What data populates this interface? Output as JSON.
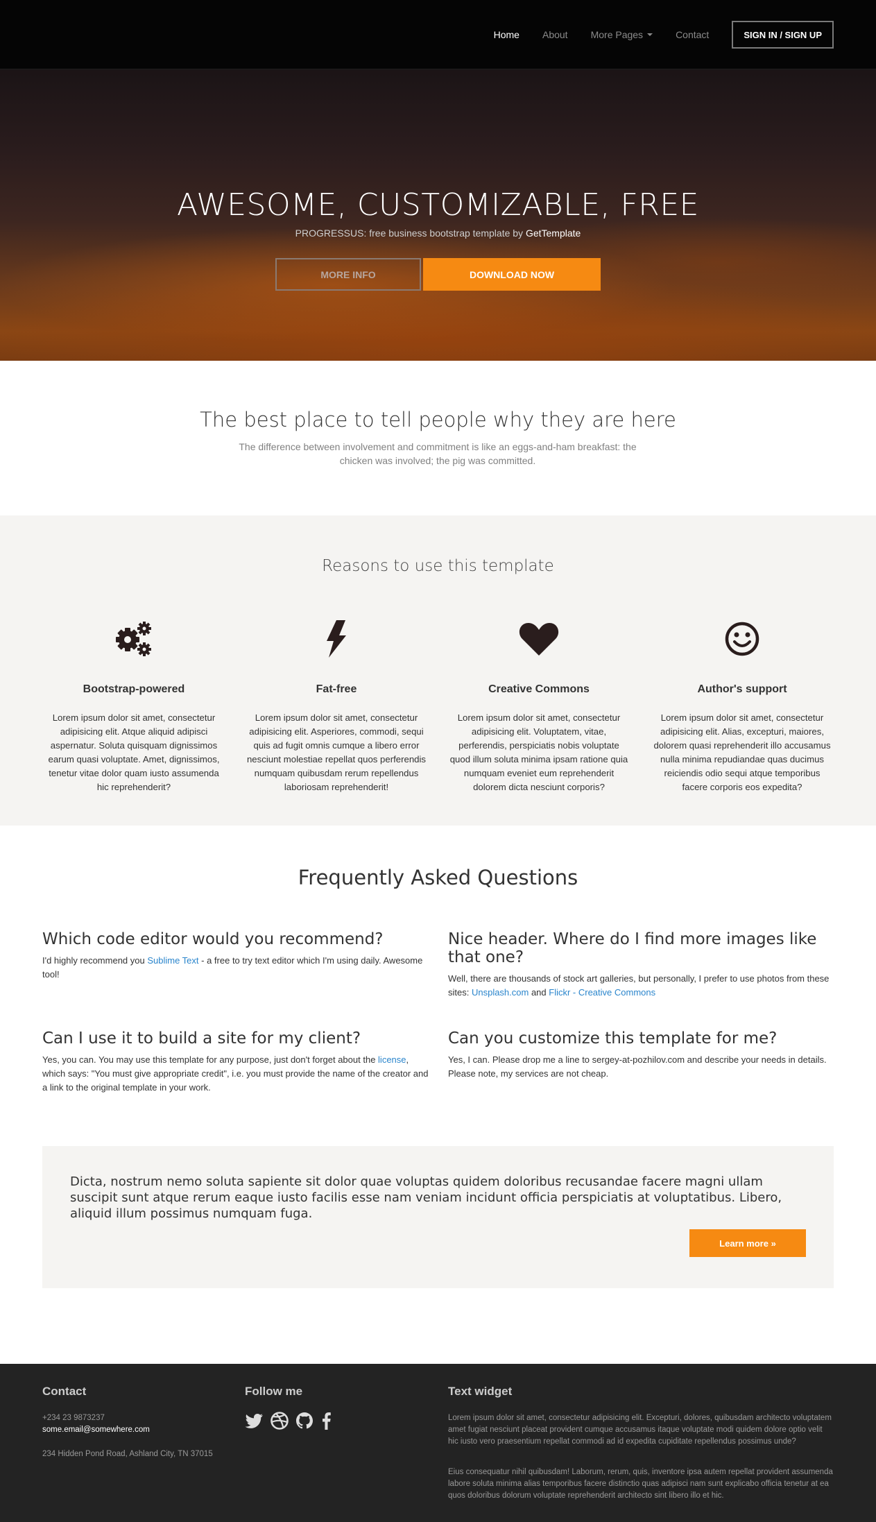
{
  "nav": {
    "items": [
      {
        "label": "Home"
      },
      {
        "label": "About"
      },
      {
        "label": "More Pages"
      },
      {
        "label": "Contact"
      }
    ],
    "signin_label": "SIGN IN / SIGN UP"
  },
  "hero": {
    "title": "AWESOME, CUSTOMIZABLE, FREE",
    "subtitle_prefix": "PROGRESSUS: free business bootstrap template by",
    "subtitle_brand": "GetTemplate",
    "more_info_label": "MORE INFO",
    "download_label": "DOWNLOAD NOW"
  },
  "tagline": {
    "title": "The best place to tell people why they are here",
    "text": "The difference between involvement and commitment is like an eggs-and-ham breakfast: the chicken was involved; the pig was committed."
  },
  "reasons": {
    "title": "Reasons to use this template",
    "features": [
      {
        "icon": "gears-icon",
        "title": "Bootstrap-powered",
        "text": "Lorem ipsum dolor sit amet, consectetur adipisicing elit. Atque aliquid adipisci aspernatur. Soluta quisquam dignissimos earum quasi voluptate. Amet, dignissimos, tenetur vitae dolor quam iusto assumenda hic reprehenderit?"
      },
      {
        "icon": "bolt-icon",
        "title": "Fat-free",
        "text": "Lorem ipsum dolor sit amet, consectetur adipisicing elit. Asperiores, commodi, sequi quis ad fugit omnis cumque a libero error nesciunt molestiae repellat quos perferendis numquam quibusdam rerum repellendus laboriosam reprehenderit!"
      },
      {
        "icon": "heart-icon",
        "title": "Creative Commons",
        "text": "Lorem ipsum dolor sit amet, consectetur adipisicing elit. Voluptatem, vitae, perferendis, perspiciatis nobis voluptate quod illum soluta minima ipsam ratione quia numquam eveniet eum reprehenderit dolorem dicta nesciunt corporis?"
      },
      {
        "icon": "smile-icon",
        "title": "Author's support",
        "text": "Lorem ipsum dolor sit amet, consectetur adipisicing elit. Alias, excepturi, maiores, dolorem quasi reprehenderit illo accusamus nulla minima repudiandae quas ducimus reiciendis odio sequi atque temporibus facere corporis eos expedita?"
      }
    ]
  },
  "faq": {
    "title": "Frequently Asked Questions",
    "q1": {
      "question": "Which code editor would you recommend?",
      "a_pre": "I'd highly recommend you ",
      "a_link": "Sublime Text",
      "a_post": " - a free to try text editor which I'm using daily. Awesome tool!"
    },
    "q2": {
      "question": "Nice header. Where do I find more images like that one?",
      "a_pre": "Well, there are thousands of stock art galleries, but personally, I prefer to use photos from these sites: ",
      "a_link1": "Unsplash.com",
      "a_mid": " and ",
      "a_link2": "Flickr - Creative Commons"
    },
    "q3": {
      "question": "Can I use it to build a site for my client?",
      "a_pre": "Yes, you can. You may use this template for any purpose, just don't forget about the ",
      "a_link": "license",
      "a_post": ", which says: \"You must give appropriate credit\", i.e. you must provide the name of the creator and a link to the original template in your work."
    },
    "q4": {
      "question": "Can you customize this template for me?",
      "answer": "Yes, I can. Please drop me a line to sergey-at-pozhilov.com and describe your needs in details. Please note, my services are not cheap."
    }
  },
  "callout": {
    "text": "Dicta, nostrum nemo soluta sapiente sit dolor quae voluptas quidem doloribus recusandae facere magni ullam suscipit sunt atque rerum eaque iusto facilis esse nam veniam incidunt officia perspiciatis at voluptatibus. Libero, aliquid illum possimus numquam fuga.",
    "button_label": "Learn more »"
  },
  "footer": {
    "contact_title": "Contact",
    "phone": "+234 23 9873237",
    "email": "some.email@somewhere.com",
    "address": "234 Hidden Pond Road, Ashland City, TN 37015",
    "follow_title": "Follow me",
    "social_icons": [
      "twitter-icon",
      "dribbble-icon",
      "github-icon",
      "facebook-icon"
    ],
    "widget_title": "Text widget",
    "widget_p1": "Lorem ipsum dolor sit amet, consectetur adipisicing elit. Excepturi, dolores, quibusdam architecto voluptatem amet fugiat nesciunt placeat provident cumque accusamus itaque voluptate modi quidem dolore optio velit hic iusto vero praesentium repellat commodi ad id expedita cupiditate repellendus possimus unde?",
    "widget_p2": "Eius consequatur nihil quibusdam! Laborum, rerum, quis, inventore ipsa autem repellat provident assumenda labore soluta minima alias temporibus facere distinctio quas adipisci nam sunt explicabo officia tenetur at ea quos doloribus dolorum voluptate reprehenderit architecto sint libero illo et hic."
  },
  "colors": {
    "accent": "#f68a12",
    "link": "#2a85cc",
    "navbar": "#050505",
    "footer": "#232323",
    "section_bg": "#f5f4f2"
  }
}
